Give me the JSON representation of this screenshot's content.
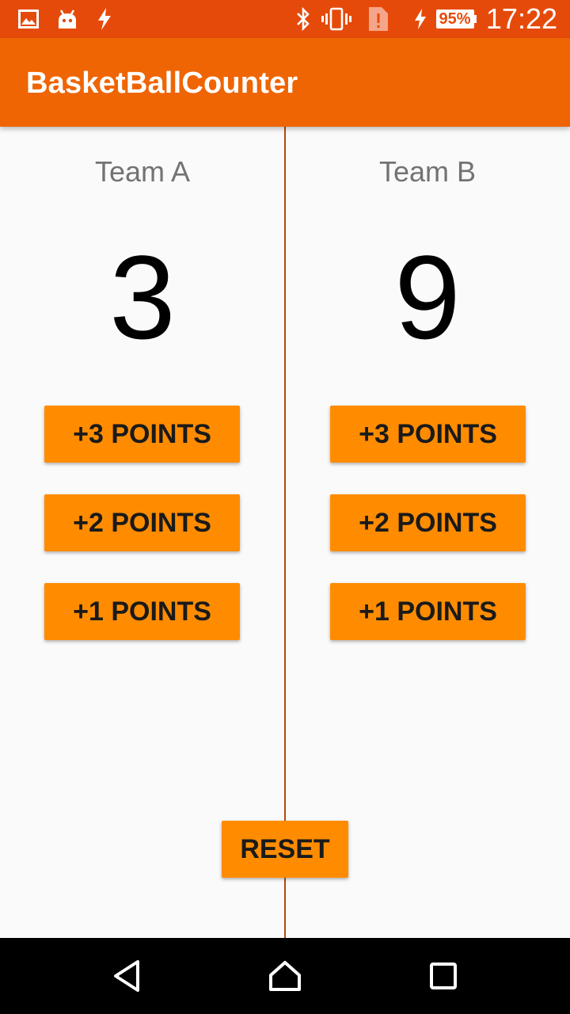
{
  "status_bar": {
    "time": "17:22",
    "battery_percent": "95%",
    "icons": [
      "image-notification-icon",
      "android-icon",
      "flash-icon",
      "bluetooth-icon",
      "vibrate-icon",
      "sim-alert-icon",
      "charging-icon",
      "battery-icon"
    ]
  },
  "app_bar": {
    "title": "BasketBallCounter"
  },
  "team_a": {
    "name": "Team A",
    "score": "3",
    "buttons": {
      "plus3": "+3 POINTS",
      "plus2": "+2 POINTS",
      "plus1": "+1 POINTS"
    }
  },
  "team_b": {
    "name": "Team B",
    "score": "9",
    "buttons": {
      "plus3": "+3 POINTS",
      "plus2": "+2 POINTS",
      "plus1": "+1 POINTS"
    }
  },
  "reset_label": "RESET",
  "nav_bar": {
    "icons": [
      "back-icon",
      "home-icon",
      "recents-icon"
    ]
  },
  "colors": {
    "status_bar": "#e64a0a",
    "app_bar": "#ef6503",
    "button": "#ff8c00",
    "divider": "#b04a0e"
  }
}
